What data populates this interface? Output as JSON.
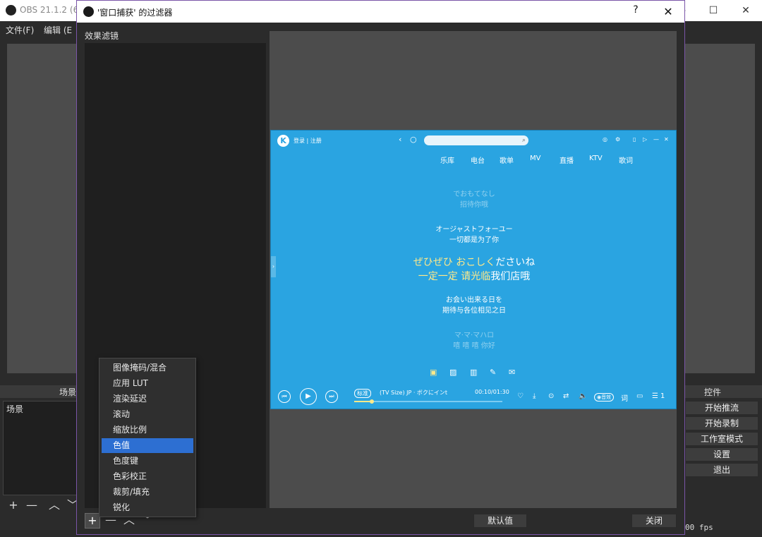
{
  "main_window": {
    "title": "OBS 21.1.2 (6",
    "menu": [
      "文件(F)",
      "编辑 (E"
    ],
    "scenes_dock_label": "场景",
    "scene_list_item": "场景",
    "controls_dock_label": "控件",
    "controls": [
      "开始推流",
      "开始录制",
      "工作室模式",
      "设置",
      "退出"
    ],
    "fps_text": "00 fps"
  },
  "dialog": {
    "title": "'窗口捕获' 的过滤器",
    "help_label": "?",
    "close_icon": "close-icon",
    "effects_label": "效果滤镜",
    "default_button": "默认值",
    "close_button": "关闭"
  },
  "popup_menu": {
    "items": [
      "图像掩码/混合",
      "应用 LUT",
      "渲染延迟",
      "滚动",
      "缩放比例",
      "色值",
      "色度键",
      "色彩校正",
      "裁剪/填充",
      "锐化"
    ],
    "highlighted_index": 5
  },
  "player": {
    "logo_letter": "K",
    "login_text": "登录 | 注册",
    "tabs": [
      "乐库",
      "电台",
      "歌单",
      "MV",
      "直播",
      "KTV",
      "歌词"
    ],
    "lyrics": [
      {
        "jp": "でおもてなし",
        "cn": "招待你哦",
        "style": "dim"
      },
      {
        "jp": "オージャストフォーユー",
        "cn": "一切都是为了你",
        "style": "mid"
      },
      {
        "jp_hl": "ぜひぜひ おこしく",
        "jp_rest": "ださいね",
        "cn_hl": "一定一定 请光临",
        "cn_rest": "我们店哦",
        "style": "big"
      },
      {
        "jp": "お会い出来る日を",
        "cn": "期待与各位相见之日",
        "style": "mid"
      },
      {
        "jp": "マ·マ·マハロ",
        "cn": "嘻 嘻 嘻 你好",
        "style": "dim"
      }
    ],
    "song_info": "(TV Size)  JP · ボクにインt",
    "quality_badge": "标准",
    "time": "00:10/01:30",
    "progress": 0.12,
    "right_icons_text": "词",
    "queue_count": "1"
  },
  "colors": {
    "accent": "#2d6fd2",
    "player_bg": "#2aa4e1",
    "dialog_border": "#7a55a8"
  }
}
